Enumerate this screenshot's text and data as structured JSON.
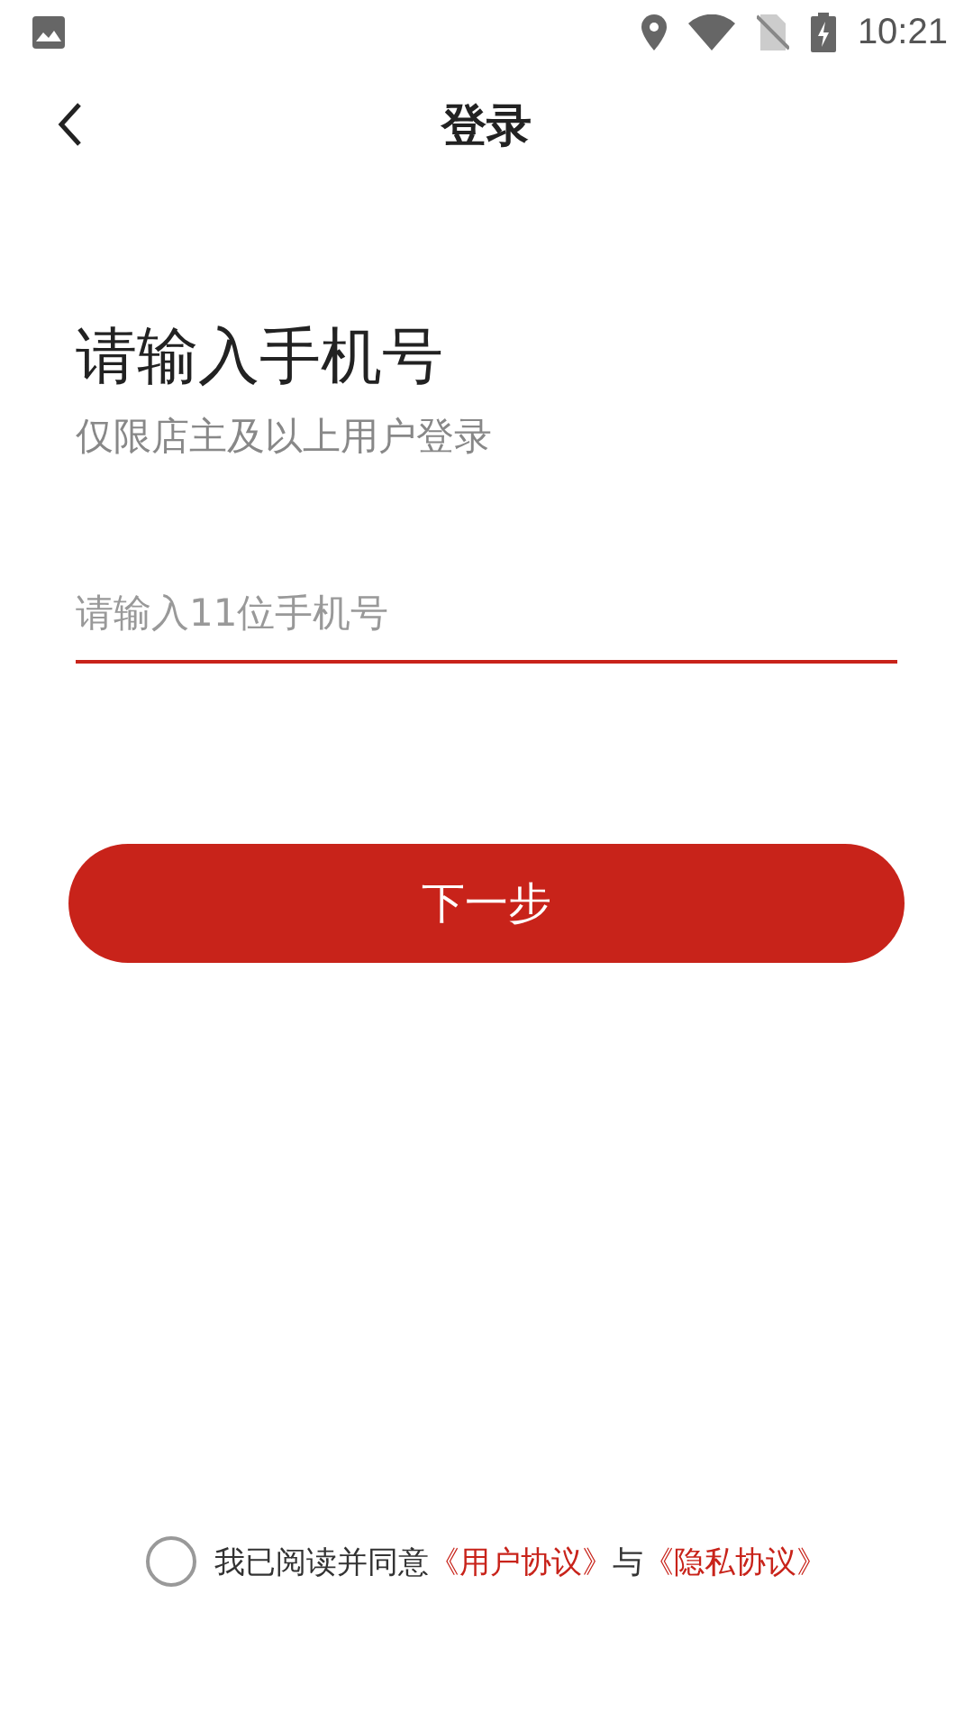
{
  "status_bar": {
    "time": "10:21"
  },
  "header": {
    "title": "登录"
  },
  "heading": "请输入手机号",
  "subtitle": "仅限店主及以上用户登录",
  "phone_field": {
    "placeholder": "请输入11位手机号"
  },
  "next_button": "下一步",
  "agreement": {
    "checked": false,
    "text": "我已阅读并同意",
    "links": [
      "《用户协议》",
      "《隐私协议》"
    ],
    "joiner": "与"
  }
}
